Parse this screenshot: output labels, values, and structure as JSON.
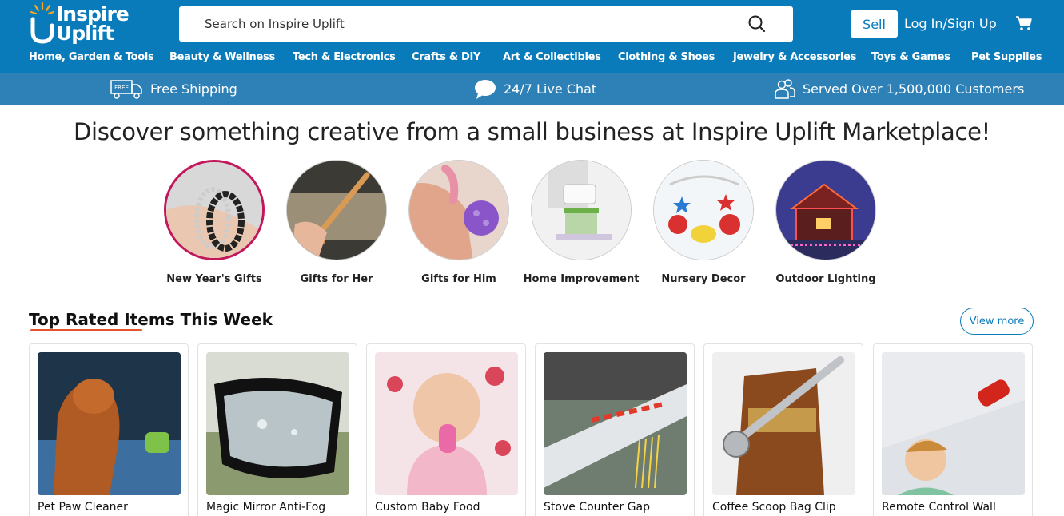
{
  "header": {
    "logo_line1": "Inspire",
    "logo_line2": "Uplift",
    "search_placeholder": "Search on Inspire Uplift",
    "sell_label": "Sell",
    "login_label": "Log In/Sign Up"
  },
  "nav": [
    "Home, Garden & Tools",
    "Beauty & Wellness",
    "Tech & Electronics",
    "Crafts & DIY",
    "Art & Collectibles",
    "Clothing & Shoes",
    "Jewelry & Accessories",
    "Toys & Games",
    "Pet Supplies"
  ],
  "infobar": {
    "free_badge": "FREE",
    "shipping": "Free Shipping",
    "chat": "24/7 Live Chat",
    "customers": "Served Over 1,500,000 Customers"
  },
  "headline": "Discover something creative from a small business at Inspire Uplift Marketplace!",
  "categories": [
    {
      "label": "New Year's Gifts",
      "icon": "bracelet-image"
    },
    {
      "label": "Gifts for Her",
      "icon": "wooden-spoon-image"
    },
    {
      "label": "Gifts for Him",
      "icon": "massage-ball-image"
    },
    {
      "label": "Home Improvement",
      "icon": "wall-diffuser-image"
    },
    {
      "label": "Nursery Decor",
      "icon": "spiderman-mobile-image"
    },
    {
      "label": "Outdoor Lighting",
      "icon": "house-lights-image"
    }
  ],
  "section": {
    "title": "Top Rated Items This Week",
    "view_more": "View more"
  },
  "products": [
    {
      "title": "Pet Paw Cleaner",
      "icon": "dog-image"
    },
    {
      "title": "Magic Mirror Anti-Fog",
      "icon": "car-mirror-image"
    },
    {
      "title": "Custom Baby Food",
      "icon": "baby-image"
    },
    {
      "title": "Stove Counter Gap",
      "icon": "counter-gap-image"
    },
    {
      "title": "Coffee Scoop Bag Clip",
      "icon": "coffee-bag-image"
    },
    {
      "title": "Remote Control Wall",
      "icon": "wall-car-image"
    }
  ],
  "colors": {
    "brand_blue": "#0a7bba",
    "infobar_blue": "#2d81b6",
    "accent_orange": "#e5542a",
    "active_ring": "#c2185b"
  }
}
